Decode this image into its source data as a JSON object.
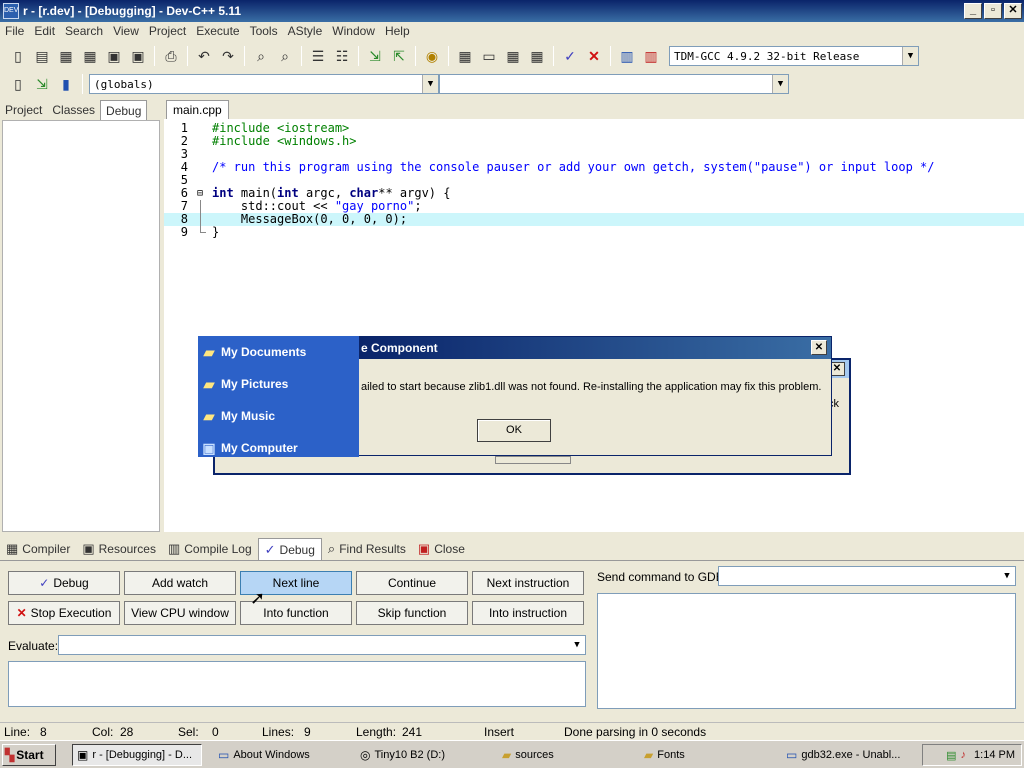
{
  "window": {
    "title": "r - [r.dev] - [Debugging] - Dev-C++ 5.11"
  },
  "menu": [
    "File",
    "Edit",
    "Search",
    "View",
    "Project",
    "Execute",
    "Tools",
    "AStyle",
    "Window",
    "Help"
  ],
  "toolbar": {
    "compiler_select": "TDM-GCC 4.9.2 32-bit Release",
    "scope_select": "(globals)"
  },
  "left_tabs": [
    "Project",
    "Classes",
    "Debug"
  ],
  "editor": {
    "file_tab": "main.cpp",
    "lines": [
      {
        "n": "1",
        "html": "<span class='pp'>#include &lt;iostream&gt;</span>"
      },
      {
        "n": "2",
        "html": "<span class='pp'>#include &lt;windows.h&gt;</span>"
      },
      {
        "n": "3",
        "html": ""
      },
      {
        "n": "4",
        "html": "<span class='cm'>/* run this program using the console pauser or add your own getch, system(\"pause\") or input loop */</span>"
      },
      {
        "n": "5",
        "html": ""
      },
      {
        "n": "6",
        "html": "<span class='kw'>int</span> main(<span class='kw'>int</span> argc, <span class='kw'>char</span>** argv) {"
      },
      {
        "n": "7",
        "html": "    std::cout &lt;&lt; <span class='str'>\"gay porno\"</span>;"
      },
      {
        "n": "8",
        "html": "    MessageBox(0, 0, 0, 0);"
      },
      {
        "n": "9",
        "html": "}"
      }
    ]
  },
  "error_dialog": {
    "title": "e Component",
    "message": "ailed to start because zlib1.dll was not found. Re-installing the application may fix this problem.",
    "ok": "OK",
    "back_text": "ck"
  },
  "start_menu": [
    "My Documents",
    "My Pictures",
    "My Music",
    "My Computer"
  ],
  "bottom_tabs": [
    "Compiler",
    "Resources",
    "Compile Log",
    "Debug",
    "Find Results",
    "Close"
  ],
  "debug": {
    "buttons_row1": [
      "Debug",
      "Add watch",
      "Next line",
      "Continue",
      "Next instruction"
    ],
    "buttons_row2": [
      "Stop Execution",
      "View CPU window",
      "Into function",
      "Skip function",
      "Into instruction"
    ],
    "evaluate_label": "Evaluate:",
    "gdb_label": "Send command to GDB:"
  },
  "status": {
    "line_label": "Line:",
    "line": "8",
    "col_label": "Col:",
    "col": "28",
    "sel_label": "Sel:",
    "sel": "0",
    "lines_label": "Lines:",
    "lines": "9",
    "length_label": "Length:",
    "length": "241",
    "mode": "Insert",
    "message": "Done parsing in 0 seconds"
  },
  "taskbar": {
    "start": "Start",
    "tasks": [
      "r - [Debugging] - D...",
      "About Windows",
      "Tiny10 B2 (D:)",
      "sources",
      "Fonts",
      "gdb32.exe - Unabl..."
    ],
    "clock": "1:14 PM"
  }
}
